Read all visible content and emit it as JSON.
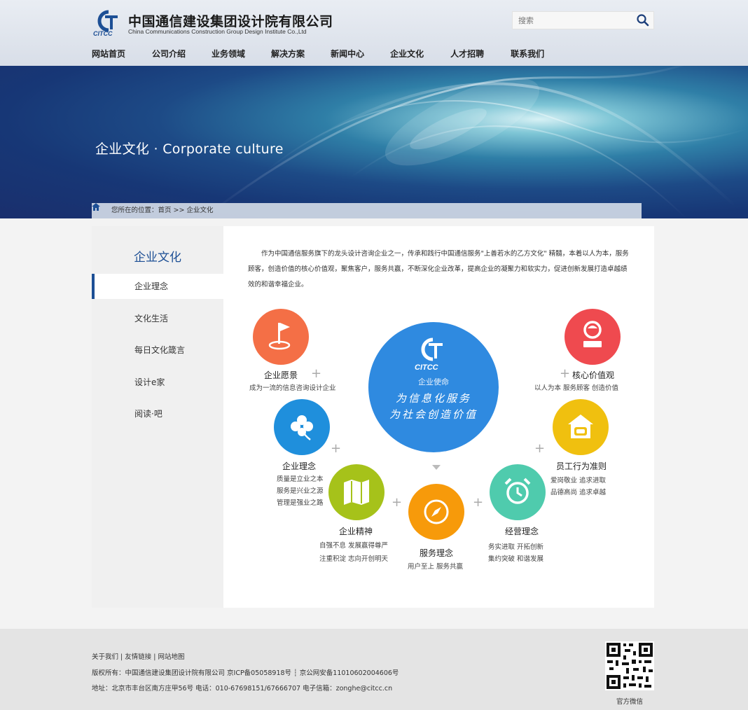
{
  "header": {
    "logo_cn": "中国通信建设集团设计院有限公司",
    "logo_en": "China Communications Construction  Group Design Institute Co.,Ltd",
    "logo_mark": "CITCC",
    "search_placeholder": "搜索"
  },
  "nav": [
    "网站首页",
    "公司介绍",
    "业务领域",
    "解决方案",
    "新闻中心",
    "企业文化",
    "人才招聘",
    "联系我们"
  ],
  "banner": {
    "title": "企业文化 · Corporate culture",
    "breadcrumb": "您所在的位置：首页 >> 企业文化"
  },
  "sidebar": {
    "title": "企业文化",
    "items": [
      "企业理念",
      "文化生活",
      "每日文化箴言",
      "设计e家",
      "阅读·吧"
    ],
    "active": "企业理念"
  },
  "content": {
    "intro": "作为中国通信服务旗下的龙头设计咨询企业之一，传承和践行中国通信服务\"上善若水的乙方文化\" 精髓，本着以人为本，服务顾客，创造价值的核心价值观，聚焦客户，服务共赢，不断深化企业改革，提高企业的凝聚力和软实力，促进创新发展打造卓越绩效的和谐幸福企业。",
    "center": {
      "logo": "CITCC",
      "label": "企业使命",
      "line1": "为信息化服务",
      "line2": "为社会创造价值"
    },
    "vision": {
      "title": "企业愿景",
      "text": "成为一流的信息咨询设计企业"
    },
    "values": {
      "title": "核心价值观",
      "text": "以人为本  服务顾客  创造价值"
    },
    "idea": {
      "title": "企业理念",
      "lines": [
        "质量是立业之本",
        "服务是兴业之源",
        "管理是强业之路"
      ]
    },
    "conduct": {
      "title": "员工行为准则",
      "lines": [
        "爱岗敬业    追求进取",
        "品德高尚    追求卓越"
      ]
    },
    "spirit": {
      "title": "企业精神",
      "lines": [
        "自强不息 发展赢得尊严",
        "注重积淀 志向开创明天"
      ]
    },
    "service": {
      "title": "服务理念",
      "lines": [
        "用户至上  服务共赢"
      ]
    },
    "operation": {
      "title": "经营理念",
      "lines": [
        "务实进取     开拓创新",
        "集约突破     和谐发展"
      ]
    },
    "colors": {
      "vision": "#f46f46",
      "values": "#ef4a4f",
      "idea": "#1f8fdc",
      "conduct": "#f0c00f",
      "spirit": "#a6c21a",
      "service": "#f79a0a",
      "operation": "#4fcbad",
      "center": "#2f8ae0"
    }
  },
  "footer": {
    "links": "关于我们 | 友情链接 | 网站地图",
    "copyright": "版权所有：中国通信建设集团设计院有限公司 京ICP备05058918号 ┆ 京公网安备11010602004606号",
    "address": "地址：北京市丰台区南方庄甲56号 电话：010-67698151/67666707    电子信箱：zonghe@citcc.cn",
    "qr_label": "官方微信"
  }
}
